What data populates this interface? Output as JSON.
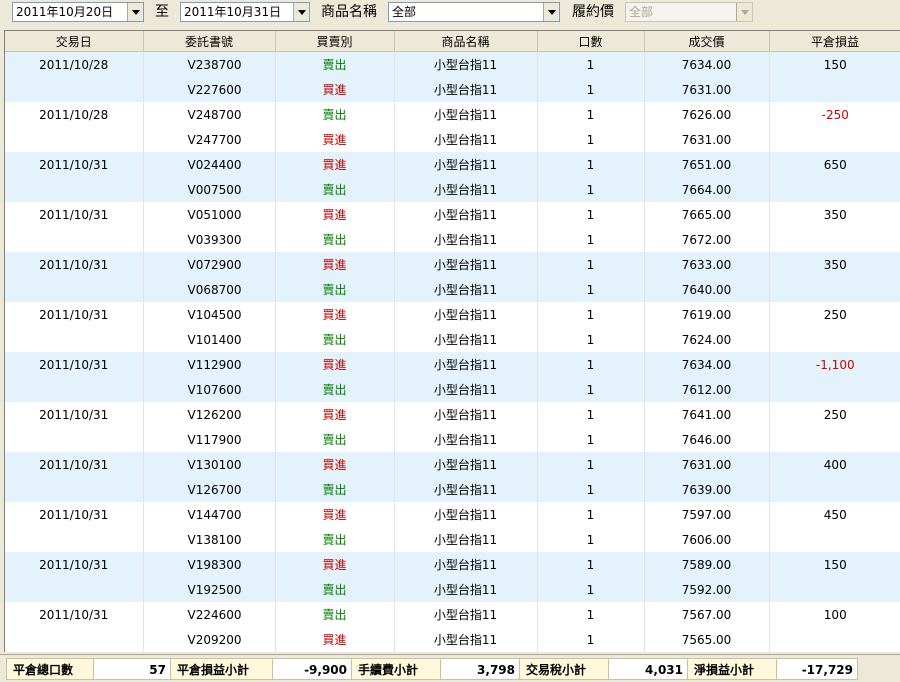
{
  "filters": {
    "date_from": "2011年10月20日",
    "to_label": "至",
    "date_to": "2011年10月31日",
    "product_label": "商品名稱",
    "product_value": "全部",
    "strike_label": "履約價",
    "strike_value": "全部"
  },
  "table": {
    "headers": [
      "交易日",
      "委託書號",
      "買賣別",
      "商品名稱",
      "口數",
      "成交價",
      "平倉損益"
    ],
    "rows": [
      [
        "2011/10/28",
        "V238700",
        "賣出",
        "小型台指11",
        "1",
        "7634.00",
        "150"
      ],
      [
        "",
        "V227600",
        "買進",
        "小型台指11",
        "1",
        "7631.00",
        ""
      ],
      [
        "2011/10/28",
        "V248700",
        "賣出",
        "小型台指11",
        "1",
        "7626.00",
        "-250"
      ],
      [
        "",
        "V247700",
        "買進",
        "小型台指11",
        "1",
        "7631.00",
        ""
      ],
      [
        "2011/10/31",
        "V024400",
        "買進",
        "小型台指11",
        "1",
        "7651.00",
        "650"
      ],
      [
        "",
        "V007500",
        "賣出",
        "小型台指11",
        "1",
        "7664.00",
        ""
      ],
      [
        "2011/10/31",
        "V051000",
        "買進",
        "小型台指11",
        "1",
        "7665.00",
        "350"
      ],
      [
        "",
        "V039300",
        "賣出",
        "小型台指11",
        "1",
        "7672.00",
        ""
      ],
      [
        "2011/10/31",
        "V072900",
        "買進",
        "小型台指11",
        "1",
        "7633.00",
        "350"
      ],
      [
        "",
        "V068700",
        "賣出",
        "小型台指11",
        "1",
        "7640.00",
        ""
      ],
      [
        "2011/10/31",
        "V104500",
        "買進",
        "小型台指11",
        "1",
        "7619.00",
        "250"
      ],
      [
        "",
        "V101400",
        "賣出",
        "小型台指11",
        "1",
        "7624.00",
        ""
      ],
      [
        "2011/10/31",
        "V112900",
        "買進",
        "小型台指11",
        "1",
        "7634.00",
        "-1,100"
      ],
      [
        "",
        "V107600",
        "賣出",
        "小型台指11",
        "1",
        "7612.00",
        ""
      ],
      [
        "2011/10/31",
        "V126200",
        "買進",
        "小型台指11",
        "1",
        "7641.00",
        "250"
      ],
      [
        "",
        "V117900",
        "賣出",
        "小型台指11",
        "1",
        "7646.00",
        ""
      ],
      [
        "2011/10/31",
        "V130100",
        "買進",
        "小型台指11",
        "1",
        "7631.00",
        "400"
      ],
      [
        "",
        "V126700",
        "賣出",
        "小型台指11",
        "1",
        "7639.00",
        ""
      ],
      [
        "2011/10/31",
        "V144700",
        "買進",
        "小型台指11",
        "1",
        "7597.00",
        "450"
      ],
      [
        "",
        "V138100",
        "賣出",
        "小型台指11",
        "1",
        "7606.00",
        ""
      ],
      [
        "2011/10/31",
        "V198300",
        "買進",
        "小型台指11",
        "1",
        "7589.00",
        "150"
      ],
      [
        "",
        "V192500",
        "賣出",
        "小型台指11",
        "1",
        "7592.00",
        ""
      ],
      [
        "2011/10/31",
        "V224600",
        "賣出",
        "小型台指11",
        "1",
        "7567.00",
        "100"
      ],
      [
        "",
        "V209200",
        "買進",
        "小型台指11",
        "1",
        "7565.00",
        ""
      ]
    ]
  },
  "summary": {
    "total_lots_label": "平倉總口數",
    "total_lots": "57",
    "pnl_label": "平倉損益小計",
    "pnl": "-9,900",
    "fee_label": "手續費小計",
    "fee": "3,798",
    "tax_label": "交易稅小計",
    "tax": "4,031",
    "net_label": "淨損益小計",
    "net": "-17,729"
  },
  "colors": {
    "sell": "#008000",
    "buy": "#c00000",
    "negative": "#d00000",
    "row_alt": "#e4f2fc"
  }
}
